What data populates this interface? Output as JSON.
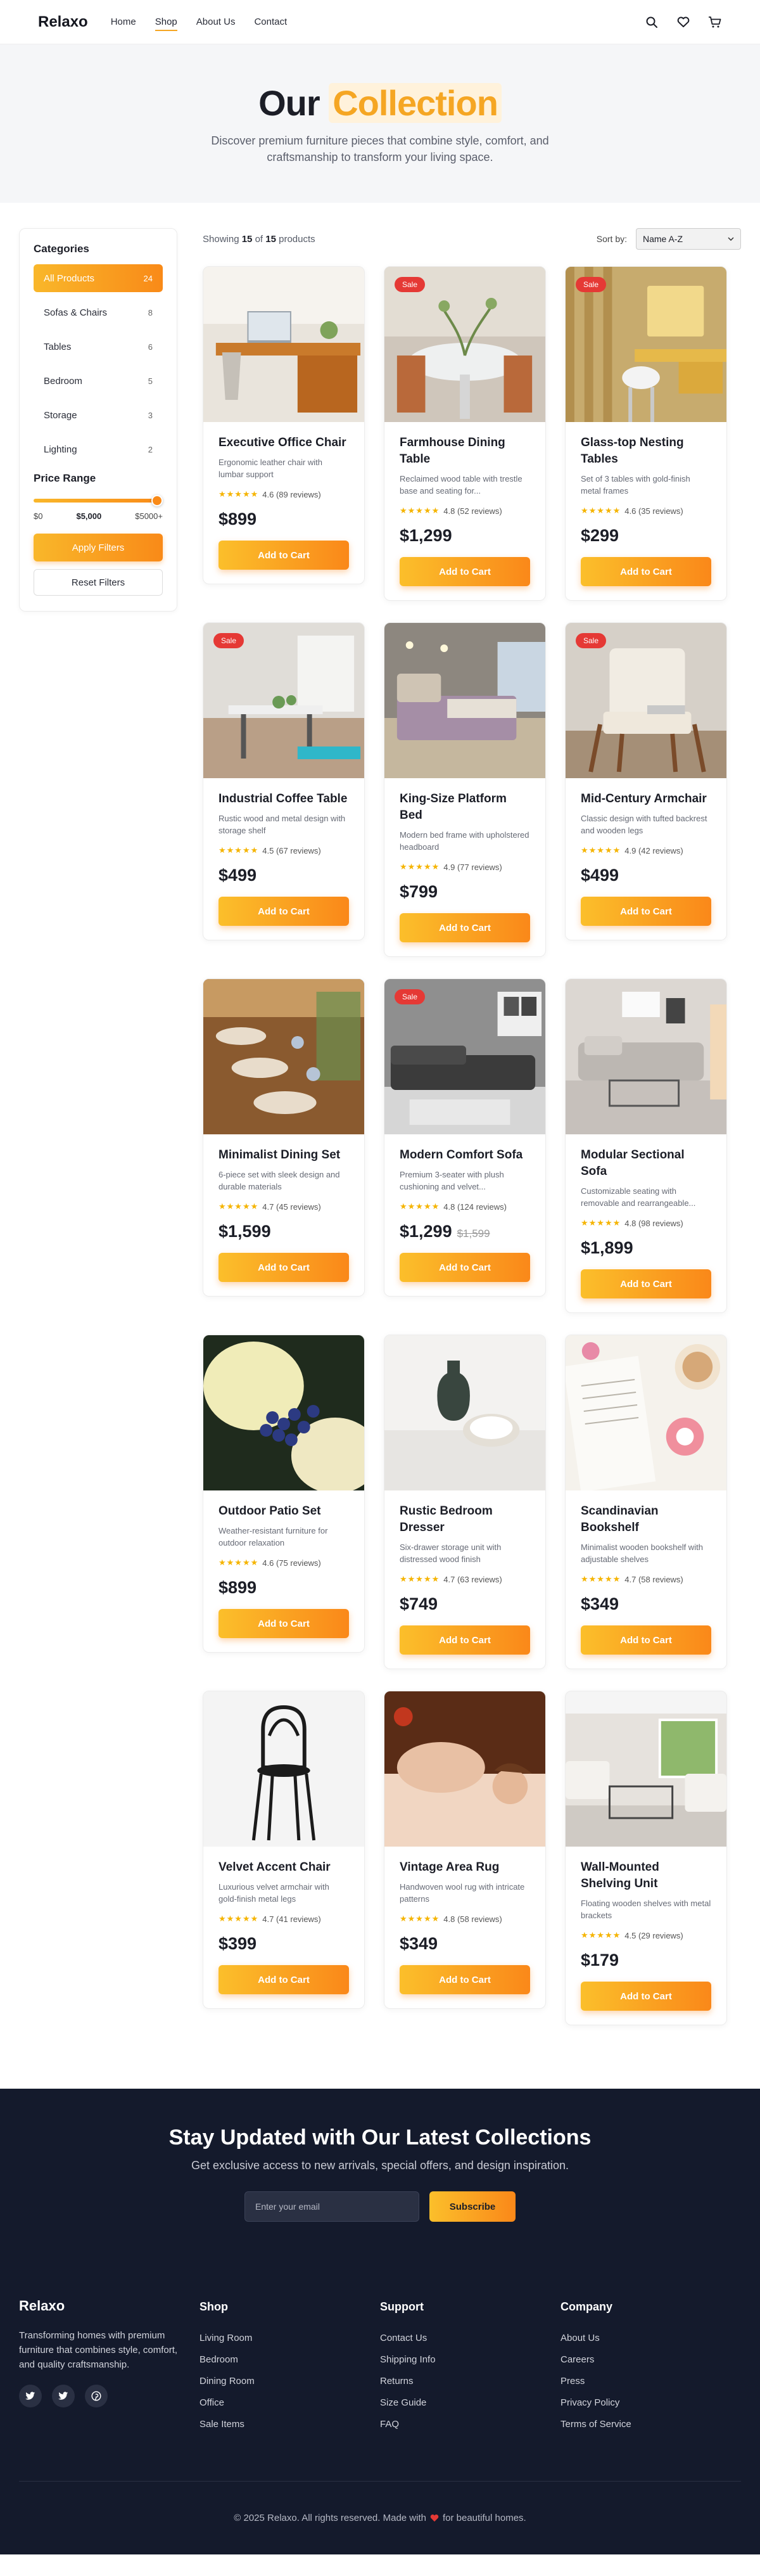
{
  "nav": {
    "brand": "Relaxo",
    "links": [
      "Home",
      "Shop",
      "About Us",
      "Contact"
    ],
    "active": "Shop",
    "icons": [
      "search-icon",
      "heart-icon",
      "cart-icon"
    ]
  },
  "hero": {
    "title_plain": "Our",
    "title_highlight": "Collection",
    "subtitle": "Discover premium furniture pieces that combine style, comfort, and craftsmanship to transform your living space."
  },
  "sidebar": {
    "categories_title": "Categories",
    "categories": [
      {
        "label": "All Products",
        "count": "24",
        "active": true
      },
      {
        "label": "Sofas & Chairs",
        "count": "8"
      },
      {
        "label": "Tables",
        "count": "6"
      },
      {
        "label": "Bedroom",
        "count": "5"
      },
      {
        "label": "Storage",
        "count": "3"
      },
      {
        "label": "Lighting",
        "count": "2"
      }
    ],
    "price_title": "Price Range",
    "price_min": "$0",
    "price_current": "$5,000",
    "price_max": "$5000+",
    "price_slider_fraction": 1.0,
    "apply_label": "Apply Filters",
    "reset_label": "Reset Filters"
  },
  "toolbar": {
    "showing_prefix": "Showing",
    "shown": "15",
    "of": "of",
    "total": "15",
    "showing_suffix": "products",
    "sort_label": "Sort by:",
    "sort_value": "Name A-Z"
  },
  "products": [
    {
      "title": "Executive Office Chair",
      "desc": "Ergonomic leather chair with lumbar support",
      "rating": "4.6 (89 reviews)",
      "price": "$899",
      "sale": false
    },
    {
      "title": "Farmhouse Dining Table",
      "desc": "Reclaimed wood table with trestle base and seating for...",
      "rating": "4.8 (52 reviews)",
      "price": "$1,299",
      "sale": true
    },
    {
      "title": "Glass-top Nesting Tables",
      "desc": "Set of 3 tables with gold-finish metal frames",
      "rating": "4.6 (35 reviews)",
      "price": "$299",
      "sale": true
    },
    {
      "title": "Industrial Coffee Table",
      "desc": "Rustic wood and metal design with storage shelf",
      "rating": "4.5 (67 reviews)",
      "price": "$499",
      "sale": true
    },
    {
      "title": "King-Size Platform Bed",
      "desc": "Modern bed frame with upholstered headboard",
      "rating": "4.9 (77 reviews)",
      "price": "$799",
      "sale": false
    },
    {
      "title": "Mid-Century Armchair",
      "desc": "Classic design with tufted backrest and wooden legs",
      "rating": "4.9 (42 reviews)",
      "price": "$499",
      "sale": true
    },
    {
      "title": "Minimalist Dining Set",
      "desc": "6-piece set with sleek design and durable materials",
      "rating": "4.7 (45 reviews)",
      "price": "$1,599",
      "sale": false
    },
    {
      "title": "Modern Comfort Sofa",
      "desc": "Premium 3-seater with plush cushioning and velvet...",
      "rating": "4.8 (124 reviews)",
      "price": "$1,299",
      "old_price": "$1,599",
      "sale": true
    },
    {
      "title": "Modular Sectional Sofa",
      "desc": "Customizable seating with removable and rearrangeable...",
      "rating": "4.8 (98 reviews)",
      "price": "$1,899",
      "sale": false
    },
    {
      "title": "Outdoor Patio Set",
      "desc": "Weather-resistant furniture for outdoor relaxation",
      "rating": "4.6 (75 reviews)",
      "price": "$899",
      "sale": false
    },
    {
      "title": "Rustic Bedroom Dresser",
      "desc": "Six-drawer storage unit with distressed wood finish",
      "rating": "4.7 (63 reviews)",
      "price": "$749",
      "sale": false
    },
    {
      "title": "Scandinavian Bookshelf",
      "desc": "Minimalist wooden bookshelf with adjustable shelves",
      "rating": "4.7 (58 reviews)",
      "price": "$349",
      "sale": false
    },
    {
      "title": "Velvet Accent Chair",
      "desc": "Luxurious velvet armchair with gold-finish metal legs",
      "rating": "4.7 (41 reviews)",
      "price": "$399",
      "sale": false
    },
    {
      "title": "Vintage Area Rug",
      "desc": "Handwoven wool rug with intricate patterns",
      "rating": "4.8 (58 reviews)",
      "price": "$349",
      "sale": false
    },
    {
      "title": "Wall-Mounted Shelving Unit",
      "desc": "Floating wooden shelves with metal brackets",
      "rating": "4.5 (29 reviews)",
      "price": "$179",
      "sale": false
    }
  ],
  "card_labels": {
    "sale": "Sale",
    "add_to_cart": "Add to Cart",
    "stars": "★★★★★"
  },
  "newsletter": {
    "title": "Stay Updated with Our Latest Collections",
    "subtitle": "Get exclusive access to new arrivals, special offers, and design inspiration.",
    "placeholder": "Enter your email",
    "button": "Subscribe"
  },
  "footer": {
    "brand": "Relaxo",
    "about": "Transforming homes with premium furniture that combines style, comfort, and quality craftsmanship.",
    "socials": [
      "twitter-icon",
      "twitter-icon",
      "pinterest-icon"
    ],
    "columns": [
      {
        "title": "Shop",
        "links": [
          "Living Room",
          "Bedroom",
          "Dining Room",
          "Office",
          "Sale Items"
        ]
      },
      {
        "title": "Support",
        "links": [
          "Contact Us",
          "Shipping Info",
          "Returns",
          "Size Guide",
          "FAQ"
        ]
      },
      {
        "title": "Company",
        "links": [
          "About Us",
          "Careers",
          "Press",
          "Privacy Policy",
          "Terms of Service"
        ]
      }
    ],
    "copyright_before": "© 2025 Relaxo. All rights reserved. Made with",
    "copyright_after": "for beautiful homes."
  },
  "colors": {
    "accent": "#f5a623",
    "accent_dark": "#f98a18",
    "sale": "#e53935",
    "dark_bg": "#141a2c"
  }
}
